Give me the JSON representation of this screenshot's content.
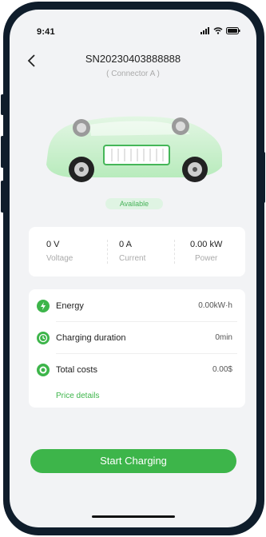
{
  "status_bar": {
    "time": "9:41"
  },
  "header": {
    "title": "SN20230403888888",
    "subtitle": "( Connector A )"
  },
  "status_badge": "Available",
  "metrics": [
    {
      "value": "0 V",
      "label": "Voltage"
    },
    {
      "value": "0 A",
      "label": "Current"
    },
    {
      "value": "0.00 kW",
      "label": "Power"
    }
  ],
  "details": [
    {
      "label": "Energy",
      "value": "0.00kW·h",
      "icon": "lightning-icon"
    },
    {
      "label": "Charging duration",
      "value": "0min",
      "icon": "clock-icon"
    },
    {
      "label": "Total costs",
      "value": "0.00$",
      "icon": "coin-icon"
    }
  ],
  "price_details": "Price details",
  "cta": "Start Charging",
  "colors": {
    "accent": "#3db54a",
    "badge_bg": "#dff4e3",
    "background": "#f2f3f5"
  }
}
